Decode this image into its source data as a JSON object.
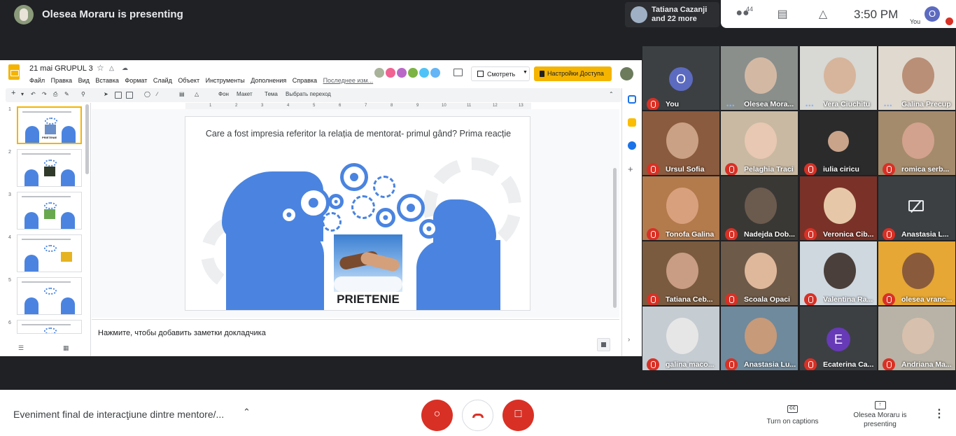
{
  "topbar": {
    "presenting_title": "Olesea Moraru is presenting",
    "speaker_chip": "Tatiana Cazanji and 22 more",
    "people_count": "44",
    "clock": "3:50 PM",
    "you_label": "You",
    "you_initial": "O"
  },
  "slides": {
    "doc_title": "21 mai  GRUPUL 3",
    "menu": [
      "Файл",
      "Правка",
      "Вид",
      "Вставка",
      "Формат",
      "Слайд",
      "Объект",
      "Инструменты",
      "Дополнения",
      "Справка"
    ],
    "last_edit": "Последнее изм...",
    "present_label": "Смотреть",
    "share_label": "Настройки Доступа",
    "toolbar": {
      "background": "Фон",
      "layout": "Макет",
      "theme": "Тема",
      "transition": "Выбрать переход"
    },
    "ruler": [
      "1",
      "2",
      "3",
      "4",
      "5",
      "6",
      "7",
      "8",
      "9",
      "10",
      "11",
      "12",
      "13"
    ],
    "thumb_numbers": [
      "1",
      "2",
      "3",
      "4",
      "5",
      "6"
    ],
    "thumb_captions": [
      "PRIETENIE",
      "",
      "",
      "",
      "",
      ""
    ],
    "slide_title": "Care a fost impresia referitor la relația de mentorat- primul gând? Prima reacție",
    "slide_caption": "PRIETENIE",
    "notes_placeholder": "Нажмите, чтобы добавить заметки докладчика"
  },
  "participants": [
    {
      "name": "You",
      "type": "avatar",
      "initial": "O",
      "avatar_color": "#5c6bc0",
      "muted": true
    },
    {
      "name": "Olesea Mora...",
      "type": "video",
      "muted": false,
      "speaking": true
    },
    {
      "name": "Vera Ciuchitu",
      "type": "video",
      "muted": false
    },
    {
      "name": "Galina Precup",
      "type": "video",
      "muted": false
    },
    {
      "name": "Ursul Sofia",
      "type": "video",
      "muted": true
    },
    {
      "name": "Pelaghia Traci",
      "type": "video",
      "muted": true
    },
    {
      "name": "iulia ciricu",
      "type": "photo",
      "muted": true
    },
    {
      "name": "romica serb...",
      "type": "video",
      "muted": true
    },
    {
      "name": "Tonofa Galina",
      "type": "video",
      "muted": true
    },
    {
      "name": "Nadejda Dob...",
      "type": "video",
      "muted": true
    },
    {
      "name": "Veronica Cib...",
      "type": "video",
      "muted": true
    },
    {
      "name": "Anastasia L...",
      "type": "no-video",
      "muted": true
    },
    {
      "name": "Tatiana Ceb...",
      "type": "video",
      "muted": true
    },
    {
      "name": "Scoala Opaci",
      "type": "video",
      "muted": true
    },
    {
      "name": "Valentina Ra...",
      "type": "video",
      "muted": true
    },
    {
      "name": "olesea vranc...",
      "type": "video",
      "muted": true
    },
    {
      "name": "galina maco...",
      "type": "video",
      "muted": true
    },
    {
      "name": "Anastasia Lu...",
      "type": "video",
      "muted": true
    },
    {
      "name": "Ecaterina Ca...",
      "type": "avatar",
      "initial": "E",
      "avatar_color": "#673ab7",
      "muted": true
    },
    {
      "name": "Andriana Ma...",
      "type": "video",
      "muted": true
    }
  ],
  "bottombar": {
    "meeting_title": "Eveniment final de interacţiune dintre mentore/...",
    "captions_label": "Turn on captions",
    "present_label": "Olesea Moraru is presenting",
    "captions_icon": "CC"
  },
  "colors": {
    "accent_red": "#d93025",
    "slides_yellow": "#f4b400",
    "slide_blue": "#4a84e0"
  }
}
